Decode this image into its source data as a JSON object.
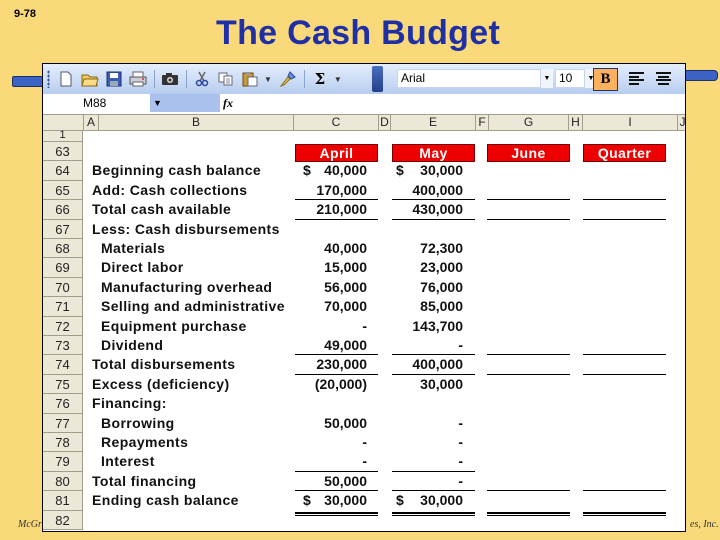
{
  "slide": {
    "number": "9-78",
    "title": "The Cash Budget",
    "footer_left": "McGr",
    "footer_right": "es, Inc."
  },
  "toolbar": {
    "icons": [
      "new-document-icon",
      "open-folder-icon",
      "save-icon",
      "print-icon",
      "camera-icon",
      "cut-icon",
      "copy-icon",
      "paste-icon",
      "format-painter-icon",
      "autosum-icon"
    ],
    "font_name": "Arial",
    "font_size": "10",
    "bold_label": "B",
    "sum_symbol": "Σ"
  },
  "formula_bar": {
    "cell_ref": "M88",
    "fx_label": "fx",
    "formula": ""
  },
  "columns": [
    "",
    "A",
    "B",
    "C",
    "D",
    "E",
    "F",
    "G",
    "H",
    "I",
    "J"
  ],
  "rows": [
    {
      "num": "1",
      "label": "",
      "april": "",
      "may": ""
    },
    {
      "num": "63",
      "label": "",
      "april": "",
      "may": ""
    },
    {
      "num": "64",
      "label": "Beginning cash balance",
      "april": "40,000",
      "may": "30,000",
      "dollar": true
    },
    {
      "num": "65",
      "label": "Add: Cash collections",
      "april": "170,000",
      "may": "400,000"
    },
    {
      "num": "66",
      "label": "Total cash available",
      "april": "210,000",
      "may": "430,000"
    },
    {
      "num": "67",
      "label": "Less: Cash disbursements",
      "april": "",
      "may": ""
    },
    {
      "num": "68",
      "label": "Materials",
      "april": "40,000",
      "may": "72,300",
      "indent": true
    },
    {
      "num": "69",
      "label": "Direct labor",
      "april": "15,000",
      "may": "23,000",
      "indent": true
    },
    {
      "num": "70",
      "label": "Manufacturing overhead",
      "april": "56,000",
      "may": "76,000",
      "indent": true
    },
    {
      "num": "71",
      "label": "Selling and administrative",
      "april": "70,000",
      "may": "85,000",
      "indent": true
    },
    {
      "num": "72",
      "label": "Equipment purchase",
      "april": "-",
      "may": "143,700",
      "indent": true
    },
    {
      "num": "73",
      "label": "Dividend",
      "april": "49,000",
      "may": "-",
      "indent": true
    },
    {
      "num": "74",
      "label": "Total disbursements",
      "april": "230,000",
      "may": "400,000"
    },
    {
      "num": "75",
      "label": "Excess (deficiency)",
      "april": "(20,000)",
      "may": "30,000"
    },
    {
      "num": "76",
      "label": "Financing:",
      "april": "",
      "may": ""
    },
    {
      "num": "77",
      "label": "Borrowing",
      "april": "50,000",
      "may": "-",
      "indent": true
    },
    {
      "num": "78",
      "label": "Repayments",
      "april": "-",
      "may": "-",
      "indent": true
    },
    {
      "num": "79",
      "label": "Interest",
      "april": "-",
      "may": "-",
      "indent": true
    },
    {
      "num": "80",
      "label": "Total financing",
      "april": "50,000",
      "may": "-"
    },
    {
      "num": "81",
      "label": "Ending cash balance",
      "april": "30,000",
      "may": "30,000",
      "dollar": true
    },
    {
      "num": "82",
      "label": "",
      "april": "",
      "may": ""
    }
  ],
  "headers": {
    "april": "April",
    "may": "May",
    "june": "June",
    "quarter": "Quarter"
  },
  "currency_symbol": "$",
  "colors": {
    "slide_bg": "#fad97b",
    "title": "#1f2fa6",
    "month_header_bg": "#ee0000",
    "bold_button_bg": "#fcb15e"
  }
}
